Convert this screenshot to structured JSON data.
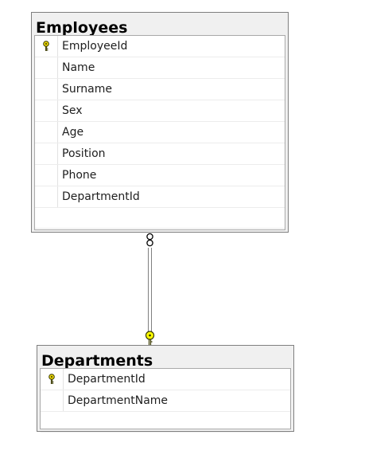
{
  "tables": [
    {
      "title": "Employees",
      "columns": [
        {
          "name": "EmployeeId",
          "primary_key": true
        },
        {
          "name": "Name",
          "primary_key": false
        },
        {
          "name": "Surname",
          "primary_key": false
        },
        {
          "name": "Sex",
          "primary_key": false
        },
        {
          "name": "Age",
          "primary_key": false
        },
        {
          "name": "Position",
          "primary_key": false
        },
        {
          "name": "Phone",
          "primary_key": false
        },
        {
          "name": "DepartmentId",
          "primary_key": false
        }
      ]
    },
    {
      "title": "Departments",
      "columns": [
        {
          "name": "DepartmentId",
          "primary_key": true
        },
        {
          "name": "DepartmentName",
          "primary_key": false
        }
      ]
    }
  ],
  "relationship": {
    "from_table": "Employees",
    "to_table": "Departments",
    "from_end": "many (infinity)",
    "to_end": "one (key)"
  },
  "colors": {
    "key_fill": "#ffff00",
    "key_stroke": "#3a3a00",
    "line": "#808080"
  }
}
